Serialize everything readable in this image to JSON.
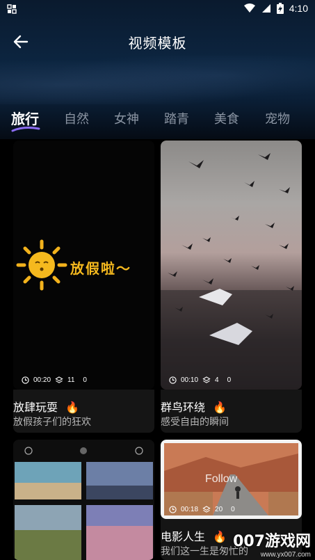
{
  "status": {
    "time": "4:10"
  },
  "header": {
    "title": "视频模板"
  },
  "tabs": [
    {
      "label": "旅行",
      "active": true
    },
    {
      "label": "自然",
      "active": false
    },
    {
      "label": "女神",
      "active": false
    },
    {
      "label": "踏青",
      "active": false
    },
    {
      "label": "美食",
      "active": false
    },
    {
      "label": "宠物",
      "active": false
    }
  ],
  "cards": [
    {
      "title": "放肆玩耍",
      "subtitle": "放假孩子们的狂欢",
      "duration": "00:20",
      "layers": "11",
      "likes": "0",
      "overlay_text": "放假啦～"
    },
    {
      "title": "群鸟环绕",
      "subtitle": "感受自由的瞬间",
      "duration": "00:10",
      "layers": "4",
      "likes": "0"
    },
    {
      "title": "",
      "subtitle": ""
    },
    {
      "title": "电影人生",
      "subtitle": "我们这一生是匆忙的",
      "duration": "00:18",
      "layers": "20",
      "likes": "0",
      "overlay_text": "Follow"
    }
  ],
  "watermark": {
    "main": "007游戏网",
    "sub": "www.yx007.com"
  }
}
